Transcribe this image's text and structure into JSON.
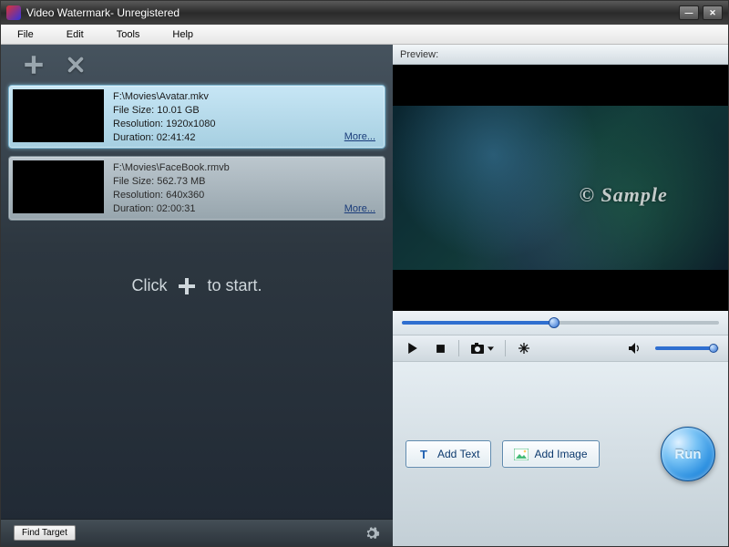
{
  "title": "Video Watermark- Unregistered",
  "menu": {
    "file": "File",
    "edit": "Edit",
    "tools": "Tools",
    "help": "Help"
  },
  "files": [
    {
      "path": "F:\\Movies\\Avatar.mkv",
      "size_label": "File Size: 10.01 GB",
      "res_label": "Resolution: 1920x1080",
      "dur_label": "Duration: 02:41:42",
      "more": "More..."
    },
    {
      "path": "F:\\Movies\\FaceBook.rmvb",
      "size_label": "File Size: 562.73 MB",
      "res_label": "Resolution: 640x360",
      "dur_label": "Duration: 02:00:31",
      "more": "More..."
    }
  ],
  "hint": {
    "pre": "Click",
    "post": "to start."
  },
  "find_target": "Find Target",
  "preview_label": "Preview:",
  "watermark": "© Sample",
  "buttons": {
    "add_text": "Add Text",
    "add_image": "Add Image",
    "run": "Run"
  },
  "seek_position_pct": 48,
  "volume_pct": 92
}
